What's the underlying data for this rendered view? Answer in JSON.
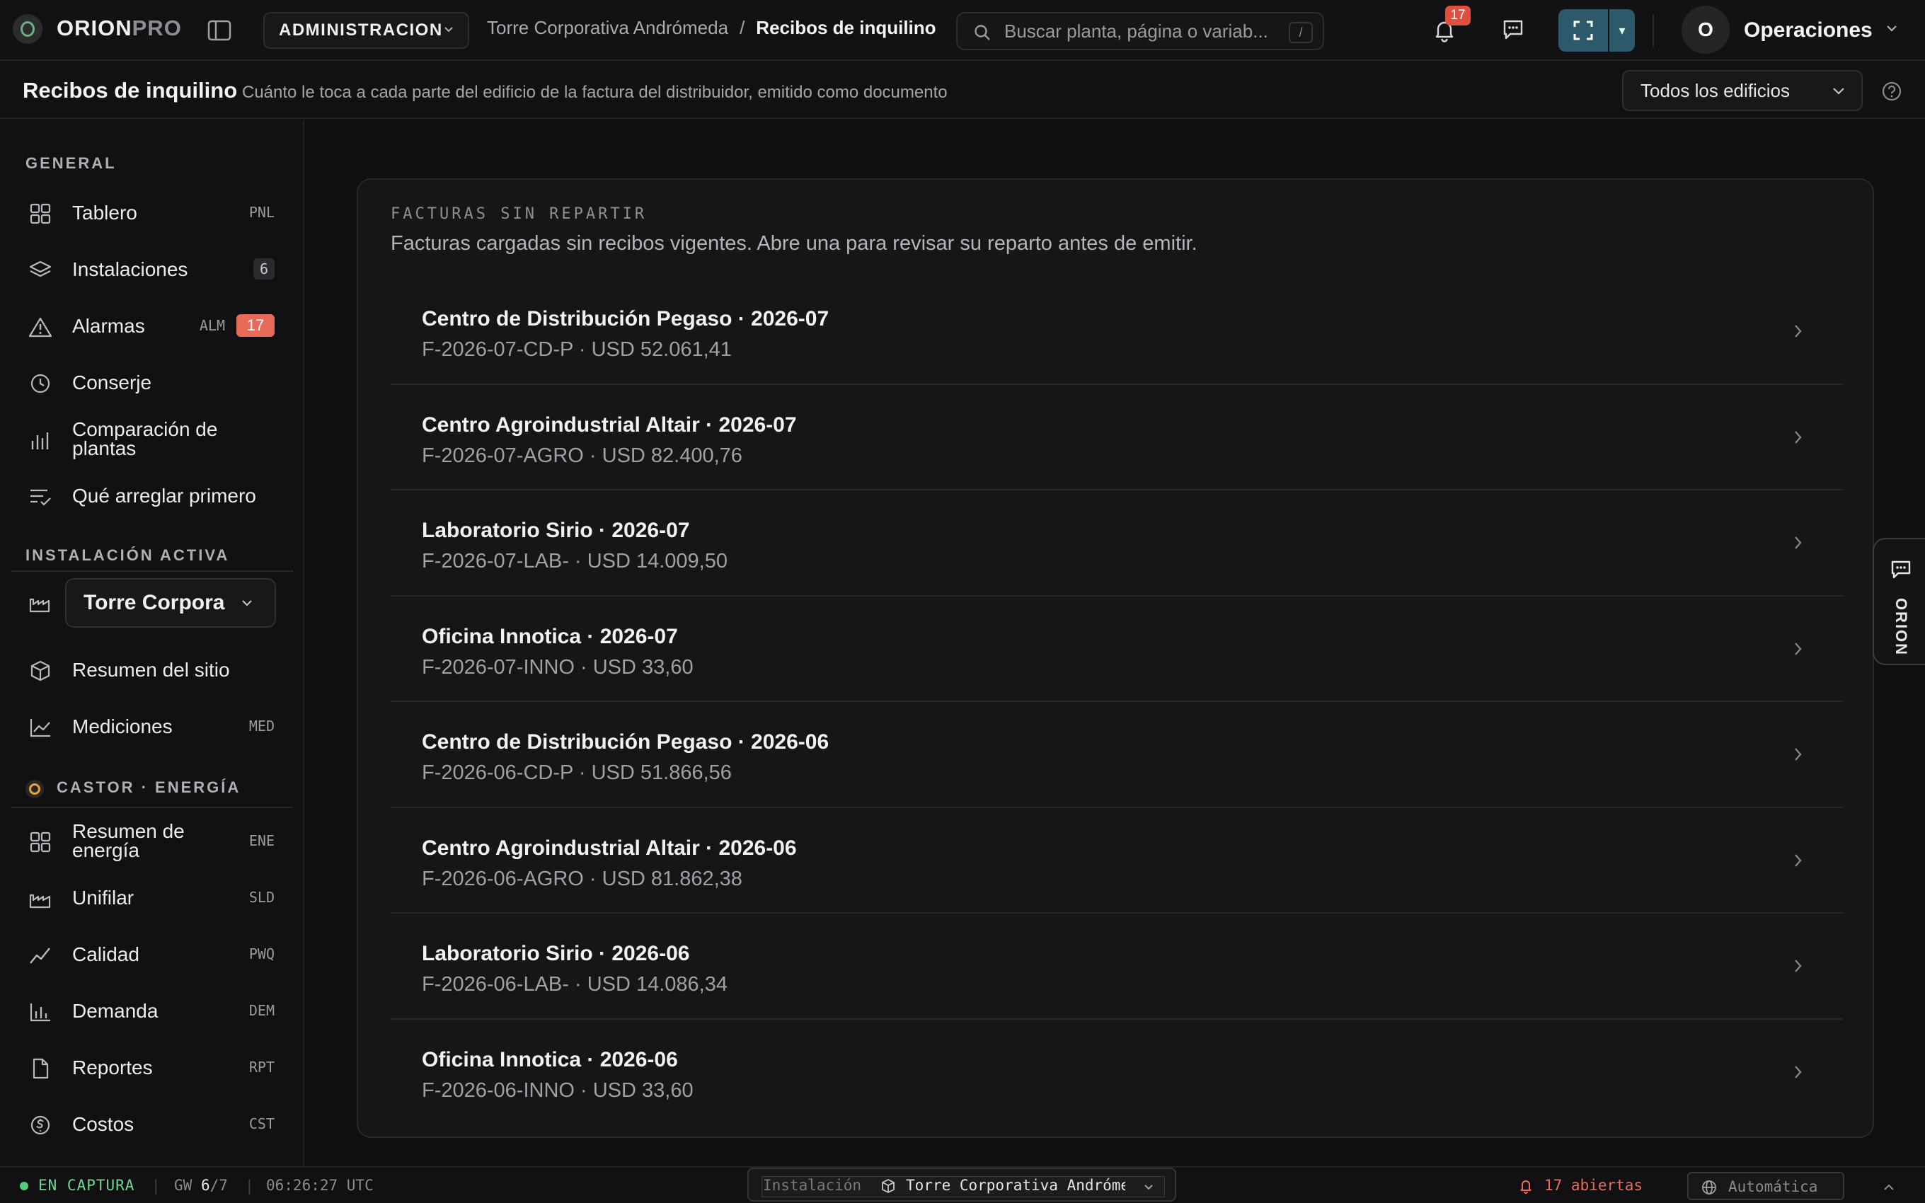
{
  "app": {
    "logo_primary": "ORION",
    "logo_secondary": "PRO"
  },
  "topbar": {
    "context": "ADMINISTRACION",
    "breadcrumb": {
      "parent": "Torre Corporativa Andrómeda",
      "separator": "/",
      "current": "Recibos de inquilino"
    },
    "search_placeholder": "Buscar planta, página o variab...",
    "search_shortcut": "/",
    "notifications_count": "17",
    "expand_dropdown": "▾",
    "user_initial": "O",
    "user_name": "Operaciones"
  },
  "page_header": {
    "title": "Recibos de inquilino",
    "subtitle": "Cuánto le toca a cada parte del edificio de la factura del distribuidor, emitido como documento",
    "building_filter": "Todos los edificios"
  },
  "sidebar": {
    "general_label": "GENERAL",
    "general_items": [
      {
        "label": "Tablero",
        "code": "PNL",
        "icon": "grid-icon"
      },
      {
        "label": "Instalaciones",
        "count": "6",
        "icon": "layers-icon"
      },
      {
        "label": "Alarmas",
        "code": "ALM",
        "badge": "17",
        "icon": "warning-icon"
      },
      {
        "label": "Conserje",
        "icon": "clock-icon"
      },
      {
        "label": "Comparación de plantas",
        "icon": "bar-chart-icon"
      },
      {
        "label": "Qué arreglar primero",
        "icon": "priority-list-icon"
      }
    ],
    "active_label": "INSTALACIÓN ACTIVA",
    "active_installation": "Torre Corporativa Andrómeda",
    "active_items": [
      {
        "label": "Resumen del sitio",
        "icon": "cube-icon"
      },
      {
        "label": "Mediciones",
        "code": "MED",
        "icon": "line-chart-icon"
      }
    ],
    "castor_label": "CASTOR · ENERGÍA",
    "castor_items": [
      {
        "label": "Resumen de energía",
        "code": "ENE",
        "icon": "grid-icon"
      },
      {
        "label": "Unifilar",
        "code": "SLD",
        "icon": "factory-icon"
      },
      {
        "label": "Calidad",
        "code": "PWQ",
        "icon": "trend-icon"
      },
      {
        "label": "Demanda",
        "code": "DEM",
        "icon": "bar-chart-icon"
      },
      {
        "label": "Reportes",
        "code": "RPT",
        "icon": "document-icon"
      },
      {
        "label": "Costos",
        "code": "CST",
        "icon": "coin-icon"
      }
    ]
  },
  "main": {
    "kicker": "FACTURAS SIN REPARTIR",
    "description": "Facturas cargadas sin recibos vigentes. Abre una para revisar su reparto antes de emitir.",
    "invoices": [
      {
        "title": "Centro de Distribución Pegaso · 2026-07",
        "meta": "F-2026-07-CD-P · USD 52.061,41"
      },
      {
        "title": "Centro Agroindustrial Altair · 2026-07",
        "meta": "F-2026-07-AGRO · USD 82.400,76"
      },
      {
        "title": "Laboratorio Sirio · 2026-07",
        "meta": "F-2026-07-LAB- · USD 14.009,50"
      },
      {
        "title": "Oficina Innotica · 2026-07",
        "meta": "F-2026-07-INNO · USD 33,60"
      },
      {
        "title": "Centro de Distribución Pegaso · 2026-06",
        "meta": "F-2026-06-CD-P · USD 51.866,56"
      },
      {
        "title": "Centro Agroindustrial Altair · 2026-06",
        "meta": "F-2026-06-AGRO · USD 81.862,38"
      },
      {
        "title": "Laboratorio Sirio · 2026-06",
        "meta": "F-2026-06-LAB- · USD 14.086,34"
      },
      {
        "title": "Oficina Innotica · 2026-06",
        "meta": "F-2026-06-INNO · USD 33,60"
      }
    ]
  },
  "side_tab": {
    "label": "ORION"
  },
  "statusbar": {
    "capture": "EN CAPTURA",
    "separator": "|",
    "gw_label": "GW",
    "gw_online": "6",
    "gw_total": "/7",
    "time": "06:26:27 UTC",
    "installation_label": "Instalación",
    "installation_value": "Torre Corporativa Andrómeda",
    "alerts": "17 abiertas",
    "mode": "Automática"
  },
  "colors": {
    "accent": "#2c5a6b",
    "alarm": "#e96a57",
    "live": "#4fcf7a",
    "background": "#101012"
  }
}
